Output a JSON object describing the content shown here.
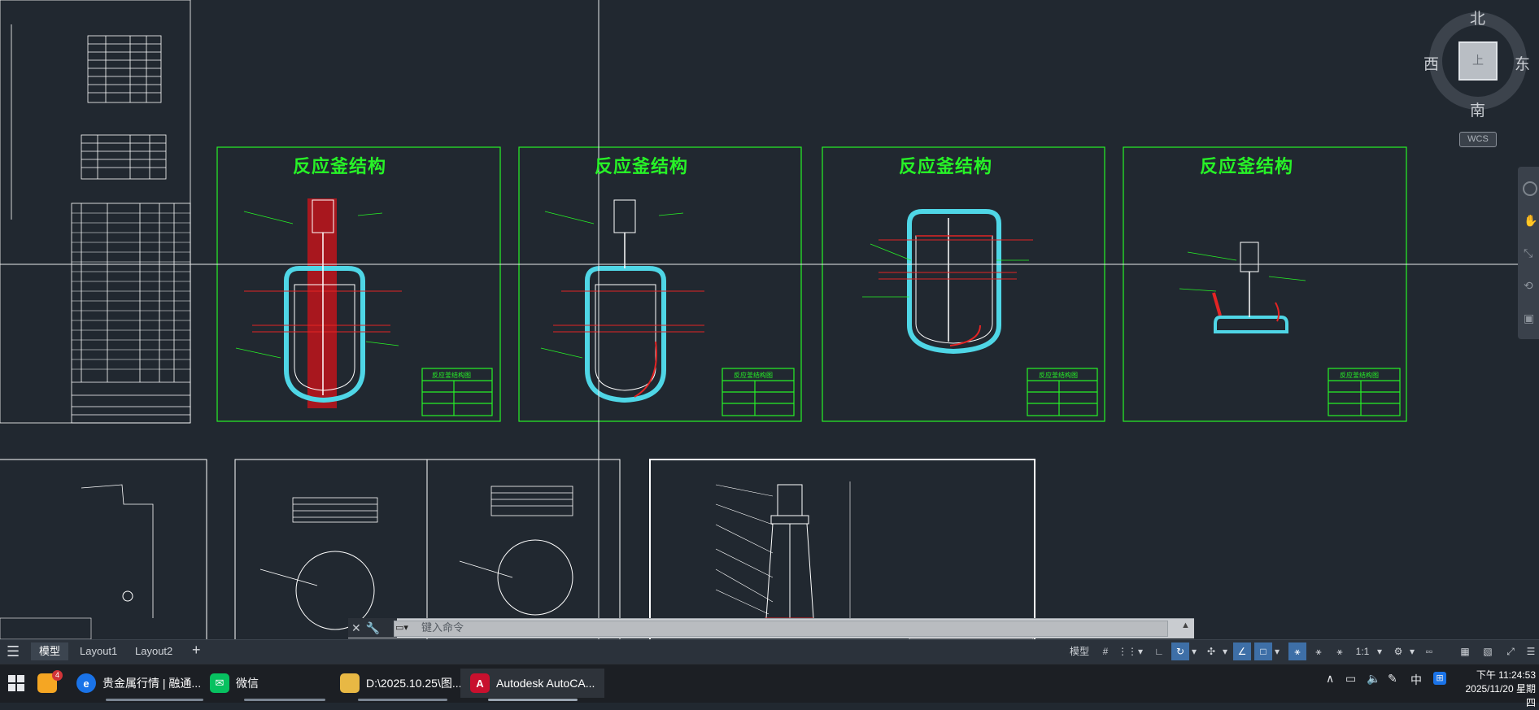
{
  "drawing": {
    "frame_titles": [
      "反应釜结构",
      "反应釜结构",
      "反应釜结构",
      "反应釜结构"
    ],
    "table_titles": [
      "反应釜结构图",
      "反应釜结构图",
      "反应釜结构图",
      "反应釜结构图"
    ]
  },
  "viewcube": {
    "north": "北",
    "south": "南",
    "east": "东",
    "west": "西",
    "face": "上",
    "wcs": "WCS"
  },
  "command": {
    "placeholder": "键入命令"
  },
  "layout_tabs": [
    {
      "label": "模型"
    },
    {
      "label": "Layout1"
    },
    {
      "label": "Layout2"
    }
  ],
  "status": {
    "model_label": "模型",
    "scale": "1:1"
  },
  "taskbar": {
    "items": [
      {
        "label": "贵金属行情 | 融通..."
      },
      {
        "label": "微信"
      },
      {
        "label": "D:\\2025.10.25\\图..."
      },
      {
        "label": "Autodesk AutoCA..."
      }
    ],
    "ime": "中",
    "time": "下午 11:24:53",
    "date": "2025/11/20 星期四",
    "badge": "4"
  },
  "colors": {
    "background": "#212830",
    "frame_green": "#27f227",
    "vessel_cyan": "#4fd6e6",
    "highlight_red": "#c0141b"
  }
}
